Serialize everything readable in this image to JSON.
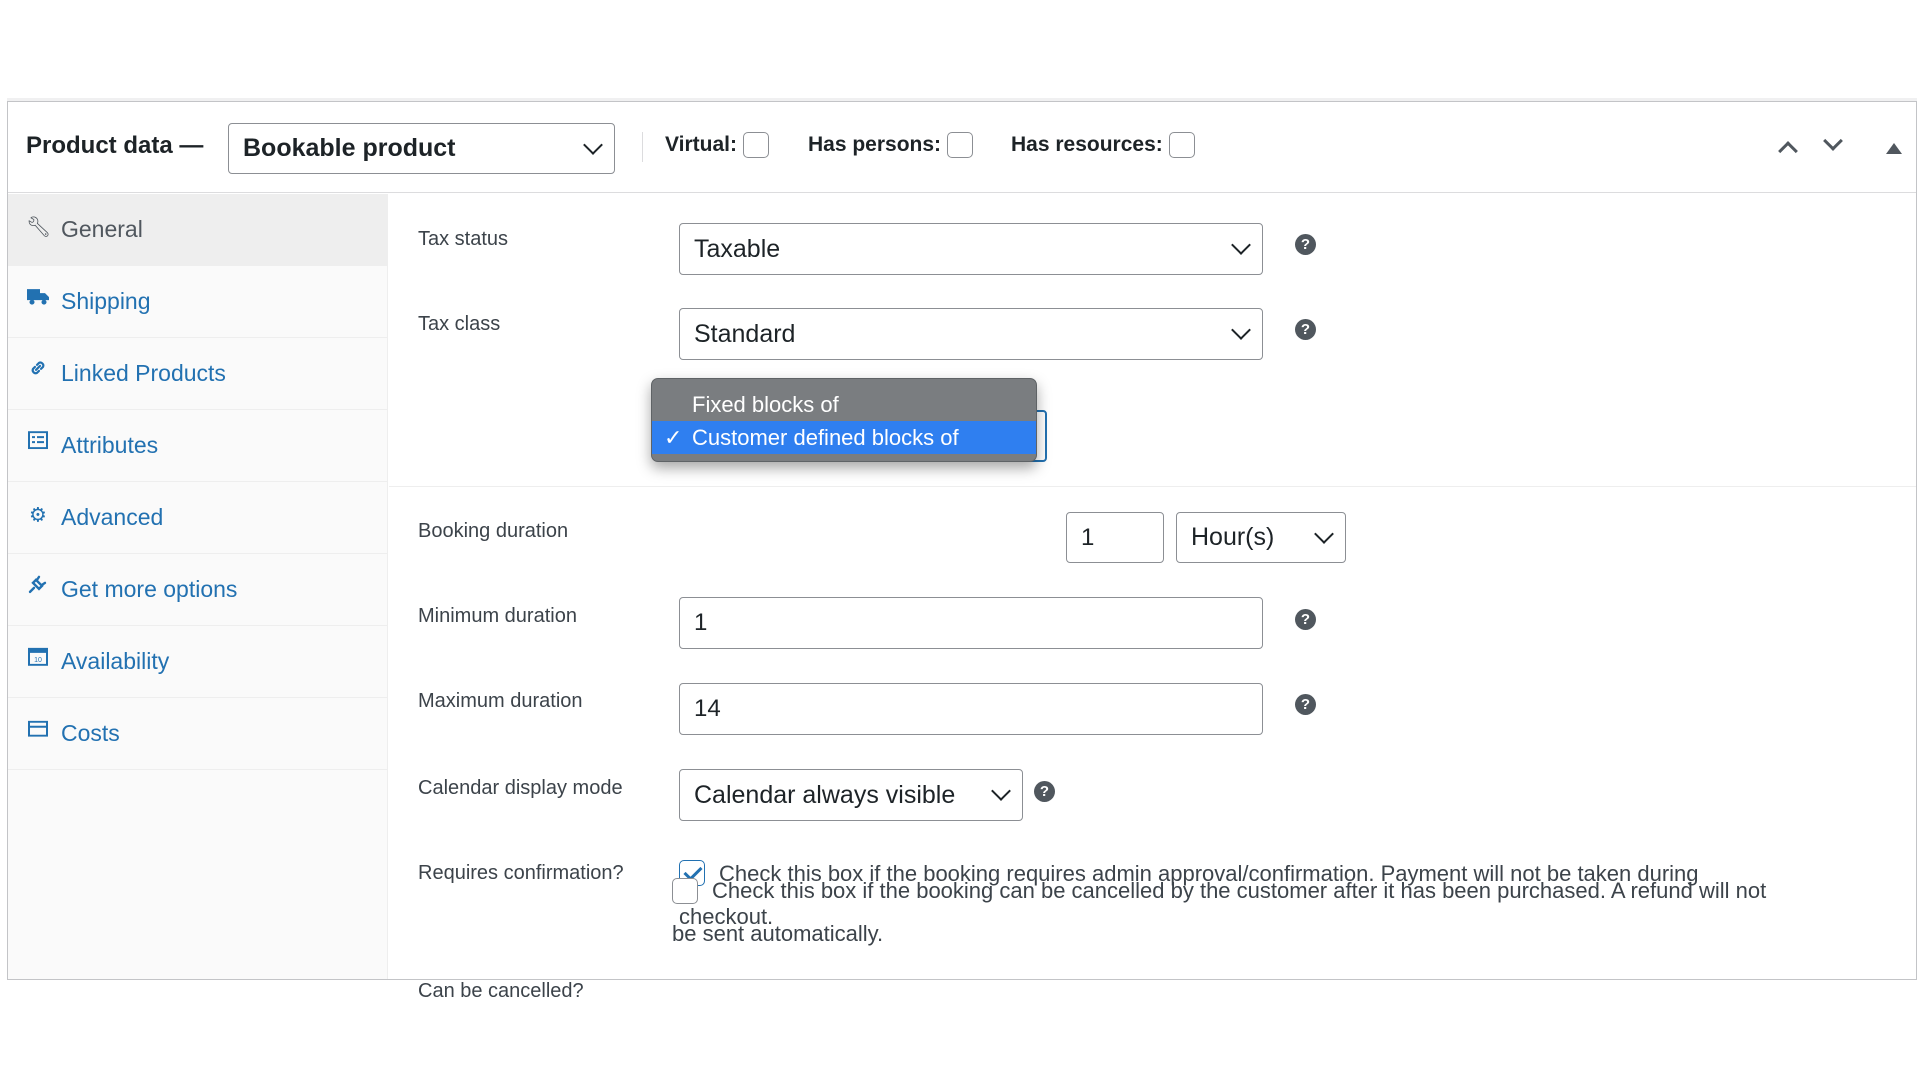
{
  "header": {
    "title": "Product data —",
    "product_type": "Bookable product",
    "virtual_label": "Virtual:",
    "has_persons_label": "Has persons:",
    "has_resources_label": "Has resources:"
  },
  "sidebar": {
    "items": [
      {
        "label": "General",
        "icon": "wrench-icon",
        "active": true
      },
      {
        "label": "Shipping",
        "icon": "truck-icon",
        "active": false
      },
      {
        "label": "Linked Products",
        "icon": "link-icon",
        "active": false
      },
      {
        "label": "Attributes",
        "icon": "list-icon",
        "active": false
      },
      {
        "label": "Advanced",
        "icon": "gear-icon",
        "active": false
      },
      {
        "label": "Get more options",
        "icon": "plug-icon",
        "active": false
      },
      {
        "label": "Availability",
        "icon": "calendar-icon",
        "active": false
      },
      {
        "label": "Costs",
        "icon": "card-icon",
        "active": false
      }
    ]
  },
  "main": {
    "tax_status": {
      "label": "Tax status",
      "value": "Taxable"
    },
    "tax_class": {
      "label": "Tax class",
      "value": "Standard"
    },
    "booking_duration": {
      "label": "Booking duration",
      "options": [
        "Fixed blocks of",
        "Customer defined blocks of"
      ],
      "selected": "Customer defined blocks of",
      "amount": "1",
      "unit": "Hour(s)"
    },
    "minimum_duration": {
      "label": "Minimum duration",
      "value": "1"
    },
    "maximum_duration": {
      "label": "Maximum duration",
      "value": "14"
    },
    "calendar_display_mode": {
      "label": "Calendar display mode",
      "value": "Calendar always visible"
    },
    "requires_confirmation": {
      "label": "Requires confirmation?",
      "line1": "Check this box if the booking requires admin approval/confirmation. Payment will not be taken during",
      "line2": "checkout."
    },
    "can_be_cancelled": {
      "label": "Can be cancelled?",
      "line1": "Check this box if the booking can be cancelled by the customer after it has been purchased. A refund will not",
      "line2": "be sent automatically."
    },
    "help_glyph": "?",
    "tick_glyph": "✓"
  },
  "colors": {
    "accent": "#2271b1",
    "selected_option": "#2f7ff0",
    "popup_bg": "#7a7d80"
  }
}
